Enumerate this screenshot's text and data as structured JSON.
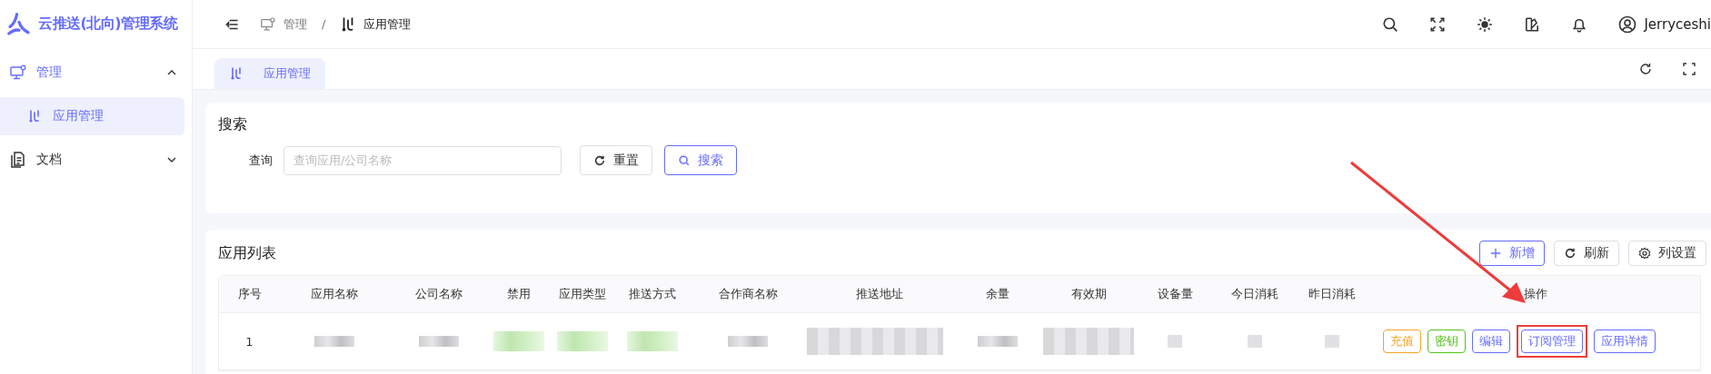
{
  "app": {
    "title": "云推送(北向)管理系统"
  },
  "sidebar": {
    "items": [
      {
        "label": "管理",
        "kind": "manage",
        "expanded": true,
        "children": [
          {
            "label": "应用管理",
            "selected": true
          }
        ]
      },
      {
        "label": "文档",
        "kind": "docs",
        "expanded": false
      }
    ]
  },
  "header": {
    "breadcrumb": [
      "管理",
      "应用管理"
    ],
    "breadcrumb_separator": "/",
    "user": "Jerryceshi"
  },
  "tabs": [
    {
      "label": "应用管理",
      "selected": true
    }
  ],
  "search": {
    "title": "搜索",
    "field_label": "查询",
    "placeholder": "查询应用/公司名称",
    "buttons": [
      {
        "label": "重置",
        "kind": "reset"
      },
      {
        "label": "搜索",
        "kind": "search"
      }
    ]
  },
  "list": {
    "title": "应用列表",
    "toolbar": [
      {
        "label": "新增",
        "kind": "add"
      },
      {
        "label": "刷新",
        "kind": "refresh"
      },
      {
        "label": "列设置",
        "kind": "settings"
      }
    ],
    "columns": [
      "序号",
      "应用名称",
      "公司名称",
      "禁用",
      "应用类型",
      "推送方式",
      "合作商名称",
      "推送地址",
      "余量",
      "有效期",
      "设备量",
      "今日消耗",
      "昨日消耗",
      "操作"
    ],
    "rows": [
      {
        "index": "1",
        "cells": [
          {
            "kind": "blur"
          },
          {
            "kind": "blur"
          },
          {
            "kind": "tag"
          },
          {
            "kind": "tag"
          },
          {
            "kind": "tag"
          },
          {
            "kind": "blur"
          },
          {
            "kind": "blur2"
          },
          {
            "kind": "blur"
          },
          {
            "kind": "blur2"
          },
          {
            "kind": "dot"
          },
          {
            "kind": "dot"
          },
          {
            "kind": "dot"
          }
        ],
        "actions": [
          {
            "label": "充值",
            "color": "#f5a623",
            "highlighted": false
          },
          {
            "label": "密钥",
            "color": "#52c41a",
            "highlighted": false
          },
          {
            "label": "编辑",
            "color": "#646cff",
            "highlighted": false
          },
          {
            "label": "订阅管理",
            "color": "#646cff",
            "highlighted": true
          },
          {
            "label": "应用详情",
            "color": "#646cff",
            "highlighted": false
          }
        ]
      }
    ]
  }
}
